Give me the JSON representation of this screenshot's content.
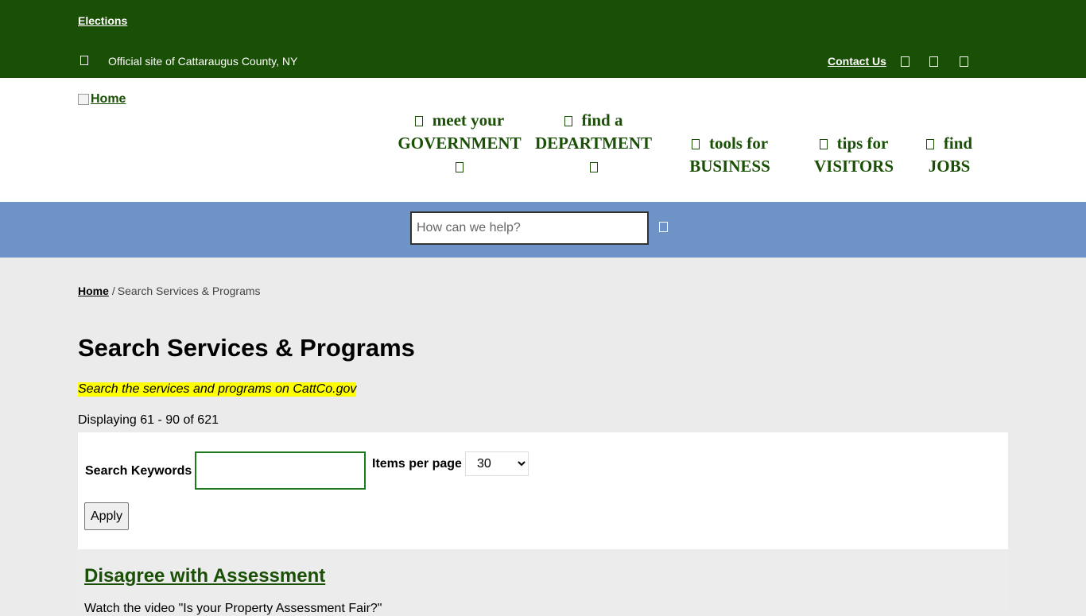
{
  "utility": {
    "elections": "Elections",
    "official": "Official site of Cattaraugus County, NY",
    "contact": "Contact Us",
    "social_icons": [
      "social-icon-1",
      "social-icon-2",
      "social-icon-3"
    ]
  },
  "header": {
    "logo_alt": "Home",
    "nav": [
      {
        "line1": "meet your",
        "line2": "GOVERNMENT",
        "has_dropdown": true
      },
      {
        "line1": "find a",
        "line2": "DEPARTMENT",
        "has_dropdown": true
      },
      {
        "line1": "tools for",
        "line2": "BUSINESS",
        "has_dropdown": false
      },
      {
        "line1": "tips for",
        "line2": "VISITORS",
        "has_dropdown": false
      },
      {
        "line1": "find",
        "line2": "JOBS",
        "has_dropdown": false
      }
    ]
  },
  "search": {
    "placeholder": "How can we help?",
    "value": ""
  },
  "breadcrumb": {
    "home": "Home",
    "separator": "/",
    "current": "Search Services & Programs"
  },
  "page": {
    "title": "Search Services & Programs",
    "lead": "Search the services and programs on CattCo.gov",
    "count": "Displaying 61 - 90 of 621"
  },
  "filters": {
    "keywords_label": "Search Keywords",
    "keywords_value": "",
    "items_label": "Items per page",
    "items_selected": "30",
    "apply": "Apply"
  },
  "results": [
    {
      "title": "Disagree with Assessment",
      "desc": "Watch the video \"Is your Property Assessment Fair?\""
    }
  ],
  "colors": {
    "brand_green": "#1a4f06",
    "search_band": "#6e93c7",
    "highlight": "#ffff00",
    "page_bg": "#ebebeb"
  }
}
